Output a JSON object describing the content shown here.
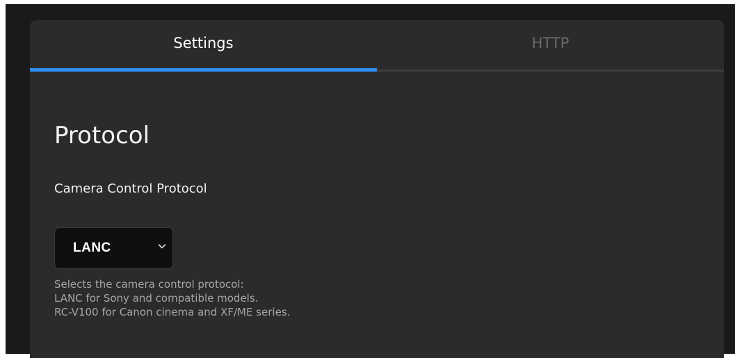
{
  "tabs": [
    {
      "label": "Settings",
      "active": true
    },
    {
      "label": "HTTP",
      "active": false
    }
  ],
  "section": {
    "title": "Protocol",
    "field_label": "Camera Control Protocol",
    "select": {
      "selected": "LANC",
      "icon": "chevron-down-icon"
    },
    "help_lines": [
      "Selects the camera control protocol:",
      "LANC for Sony and compatible models.",
      "RC-V100 for Canon cinema and XF/ME series."
    ]
  },
  "colors": {
    "accent": "#2f8cf0",
    "panel_background": "#2b2b2b",
    "outer_background": "#1a1a1a",
    "select_background": "#0f0f0f"
  }
}
